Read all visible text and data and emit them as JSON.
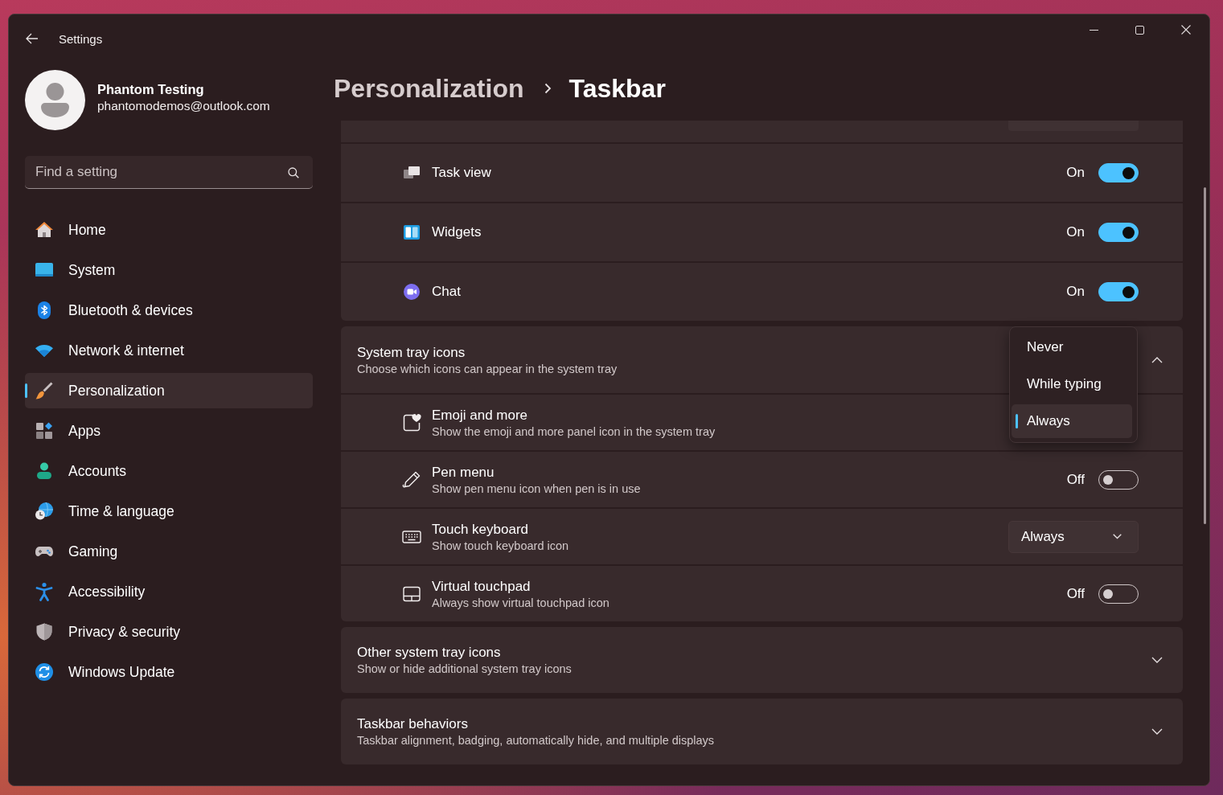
{
  "window": {
    "title": "Settings"
  },
  "profile": {
    "name": "Phantom Testing",
    "email": "phantomodemos@outlook.com"
  },
  "search": {
    "placeholder": "Find a setting"
  },
  "sidebar": {
    "items": [
      {
        "label": "Home",
        "selected": false
      },
      {
        "label": "System",
        "selected": false
      },
      {
        "label": "Bluetooth & devices",
        "selected": false
      },
      {
        "label": "Network & internet",
        "selected": false
      },
      {
        "label": "Personalization",
        "selected": true
      },
      {
        "label": "Apps",
        "selected": false
      },
      {
        "label": "Accounts",
        "selected": false
      },
      {
        "label": "Time & language",
        "selected": false
      },
      {
        "label": "Gaming",
        "selected": false
      },
      {
        "label": "Accessibility",
        "selected": false
      },
      {
        "label": "Privacy & security",
        "selected": false
      },
      {
        "label": "Windows Update",
        "selected": false
      }
    ]
  },
  "breadcrumb": {
    "parent": "Personalization",
    "current": "Taskbar"
  },
  "taskbar_items": {
    "rows": [
      {
        "kind": "toggle",
        "label": "Task view",
        "state_label": "On",
        "on": true
      },
      {
        "kind": "toggle",
        "label": "Widgets",
        "state_label": "On",
        "on": true
      },
      {
        "kind": "toggle",
        "label": "Chat",
        "state_label": "On",
        "on": true
      }
    ]
  },
  "system_tray_icons": {
    "title": "System tray icons",
    "subtitle": "Choose which icons can appear in the system tray",
    "expanded": true,
    "rows": [
      {
        "kind": "dropdown",
        "label": "Emoji and more",
        "description": "Show the emoji and more panel icon in the system tray",
        "open": true,
        "options": [
          {
            "label": "Never",
            "selected": false
          },
          {
            "label": "While typing",
            "selected": false
          },
          {
            "label": "Always",
            "selected": true
          }
        ]
      },
      {
        "kind": "toggle",
        "label": "Pen menu",
        "description": "Show pen menu icon when pen is in use",
        "state_label": "Off",
        "on": false
      },
      {
        "kind": "dropdown",
        "label": "Touch keyboard",
        "description": "Show touch keyboard icon",
        "open": false,
        "value": "Always"
      },
      {
        "kind": "toggle",
        "label": "Virtual touchpad",
        "description": "Always show virtual touchpad icon",
        "state_label": "Off",
        "on": false
      }
    ]
  },
  "sections": [
    {
      "title": "Other system tray icons",
      "subtitle": "Show or hide additional system tray icons",
      "expanded": false
    },
    {
      "title": "Taskbar behaviors",
      "subtitle": "Taskbar alignment, badging, automatically hide, and multiple displays",
      "expanded": false
    }
  ]
}
